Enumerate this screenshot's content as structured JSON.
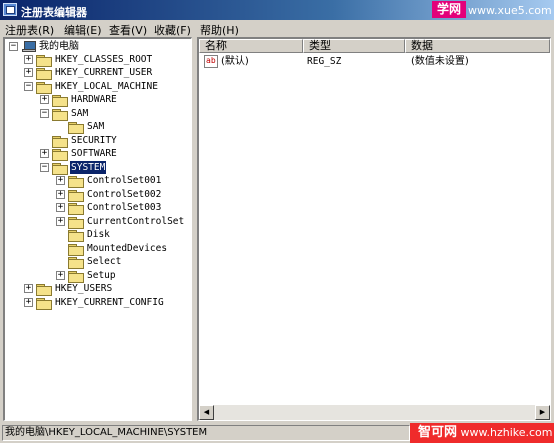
{
  "window": {
    "title": "注册表编辑器"
  },
  "watermark_top": {
    "badge": "学网",
    "url": "www.xue5.com"
  },
  "menu": [
    "注册表(R)",
    "编辑(E)",
    "查看(V)",
    "收藏(F)",
    "帮助(H)"
  ],
  "tree": [
    {
      "label": "我的电脑",
      "toggle": "−"
    },
    {
      "label": "HKEY_CLASSES_ROOT",
      "toggle": "+"
    },
    {
      "label": "HKEY_CURRENT_USER",
      "toggle": "+"
    },
    {
      "label": "HKEY_LOCAL_MACHINE",
      "toggle": "−"
    },
    {
      "label": "HARDWARE",
      "toggle": "+"
    },
    {
      "label": "SAM",
      "toggle": "−"
    },
    {
      "label": "SAM",
      "toggle": ""
    },
    {
      "label": "SECURITY",
      "toggle": ""
    },
    {
      "label": "SOFTWARE",
      "toggle": "+"
    },
    {
      "label": "SYSTEM",
      "toggle": "−"
    },
    {
      "label": "ControlSet001",
      "toggle": "+"
    },
    {
      "label": "ControlSet002",
      "toggle": "+"
    },
    {
      "label": "ControlSet003",
      "toggle": "+"
    },
    {
      "label": "CurrentControlSet",
      "toggle": "+"
    },
    {
      "label": "Disk",
      "toggle": ""
    },
    {
      "label": "MountedDevices",
      "toggle": ""
    },
    {
      "label": "Select",
      "toggle": ""
    },
    {
      "label": "Setup",
      "toggle": "+"
    },
    {
      "label": "HKEY_USERS",
      "toggle": "+"
    },
    {
      "label": "HKEY_CURRENT_CONFIG",
      "toggle": "+"
    }
  ],
  "list": {
    "columns": [
      "名称",
      "类型",
      "数据"
    ],
    "rows": [
      {
        "icon": "ab",
        "name": "(默认)",
        "type": "REG_SZ",
        "data": "(数值未设置)"
      }
    ]
  },
  "scrollbar": {
    "left": "◀",
    "right": "▶"
  },
  "status": "我的电脑\\HKEY_LOCAL_MACHINE\\SYSTEM",
  "watermark_bottom": {
    "badge": "智可网",
    "url": "www.hzhike.com"
  }
}
